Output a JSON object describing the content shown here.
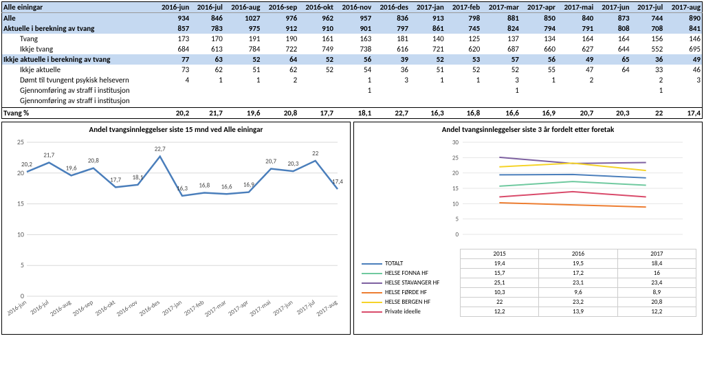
{
  "table": {
    "cols": [
      "Alle einingar",
      "2016-jun",
      "2016-jul",
      "2016-aug",
      "2016-sep",
      "2016-okt",
      "2016-nov",
      "2016-des",
      "2017-jan",
      "2017-feb",
      "2017-mar",
      "2017-apr",
      "2017-mai",
      "2017-jun",
      "2017-jul",
      "2017-aug"
    ],
    "rows": [
      {
        "cls": "hdr",
        "c": [
          "Alle",
          "934",
          "846",
          "1027",
          "976",
          "962",
          "957",
          "836",
          "913",
          "798",
          "881",
          "850",
          "840",
          "873",
          "744",
          "890"
        ]
      },
      {
        "cls": "hdr",
        "c": [
          "Aktuelle i berekning av tvang",
          "857",
          "783",
          "975",
          "912",
          "910",
          "901",
          "797",
          "861",
          "745",
          "824",
          "794",
          "791",
          "808",
          "708",
          "841"
        ]
      },
      {
        "cls": "sub2",
        "c": [
          "Tvang",
          "173",
          "170",
          "191",
          "190",
          "161",
          "163",
          "181",
          "140",
          "125",
          "137",
          "134",
          "164",
          "164",
          "156",
          "146"
        ]
      },
      {
        "cls": "sub2",
        "c": [
          "Ikkje tvang",
          "684",
          "613",
          "784",
          "722",
          "749",
          "738",
          "616",
          "721",
          "620",
          "687",
          "660",
          "627",
          "644",
          "552",
          "695"
        ]
      },
      {
        "cls": "hdr",
        "c": [
          "Ikkje aktuelle i berekning av tvang",
          "77",
          "63",
          "52",
          "64",
          "52",
          "56",
          "39",
          "52",
          "53",
          "57",
          "56",
          "49",
          "65",
          "36",
          "49"
        ]
      },
      {
        "cls": "sub2",
        "c": [
          "Ikkje aktuelle",
          "73",
          "62",
          "51",
          "62",
          "52",
          "54",
          "36",
          "51",
          "52",
          "52",
          "55",
          "47",
          "64",
          "33",
          "46"
        ]
      },
      {
        "cls": "sub2",
        "c": [
          "Dømt til tvungent psykisk helsevern",
          "4",
          "1",
          "1",
          "2",
          "",
          "1",
          "3",
          "1",
          "1",
          "3",
          "1",
          "2",
          "",
          "2",
          "3"
        ]
      },
      {
        "cls": "sub2",
        "c": [
          "Gjennomføring av straff i institusjon",
          "",
          "",
          "",
          "",
          "",
          "1",
          "",
          "",
          "",
          "1",
          "",
          "",
          "",
          "1",
          ""
        ]
      },
      {
        "cls": "sub2",
        "c": [
          "Gjennomføring av straff i institusjon",
          "",
          "",
          "",
          "",
          "",
          "",
          "",
          "",
          "",
          "",
          "",
          "",
          "",
          "",
          ""
        ]
      },
      {
        "cls": "sub2",
        "c": [
          "",
          "",
          "",
          "",
          "",
          "",
          "",
          "",
          "",
          "",
          "",
          "",
          "",
          "",
          "",
          ""
        ]
      },
      {
        "cls": "tot",
        "c": [
          "Tvang %",
          "20,2",
          "21,7",
          "19,6",
          "20,8",
          "17,7",
          "18,1",
          "22,7",
          "16,3",
          "16,8",
          "16,6",
          "16,9",
          "20,7",
          "20,3",
          "22",
          "17,4"
        ]
      }
    ]
  },
  "chart_data": [
    {
      "type": "line",
      "title": "Andel tvangsinnleggelser siste 15 mnd ved Alle einingar",
      "categories": [
        "2016-jun",
        "2016-jul",
        "2016-aug",
        "2016-sep",
        "2016-okt",
        "2016-nov",
        "2016-des",
        "2017-jan",
        "2017-feb",
        "2017-mar",
        "2017-apr",
        "2017-mai",
        "2017-jun",
        "2017-jul",
        "2017-aug"
      ],
      "values": [
        20.2,
        21.7,
        19.6,
        20.8,
        17.7,
        18.1,
        22.7,
        16.3,
        16.8,
        16.6,
        16.9,
        20.7,
        20.3,
        22,
        17.4
      ],
      "ylim": [
        0,
        25
      ],
      "yticks": [
        0,
        5,
        10,
        15,
        20,
        25
      ],
      "color": "#4a7ebb"
    },
    {
      "type": "line",
      "title": "Andel tvangsinnleggelser siste 3 år fordelt etter foretak",
      "categories": [
        "2015",
        "2016",
        "2017"
      ],
      "series": [
        {
          "name": "TOTALT",
          "color": "#4a7ebb",
          "values": [
            19.4,
            19.5,
            18.4
          ]
        },
        {
          "name": "HELSE FONNA HF",
          "color": "#6fc99f",
          "values": [
            15.7,
            17.2,
            16
          ]
        },
        {
          "name": "HELSE STAVANGER HF",
          "color": "#7d60a0",
          "values": [
            25.1,
            23.1,
            23.4
          ]
        },
        {
          "name": "HELSE FØRDE HF",
          "color": "#ed7d31",
          "values": [
            10.3,
            9.6,
            8.9
          ]
        },
        {
          "name": "HELSE BERGEN HF",
          "color": "#f5d328",
          "values": [
            22,
            23.2,
            20.8
          ]
        },
        {
          "name": "Private ideelle",
          "color": "#d94a6a",
          "values": [
            12.2,
            13.9,
            12.2
          ]
        }
      ],
      "ylim": [
        0,
        30
      ],
      "yticks": [
        0,
        5,
        10,
        15,
        20,
        25,
        30
      ]
    }
  ]
}
